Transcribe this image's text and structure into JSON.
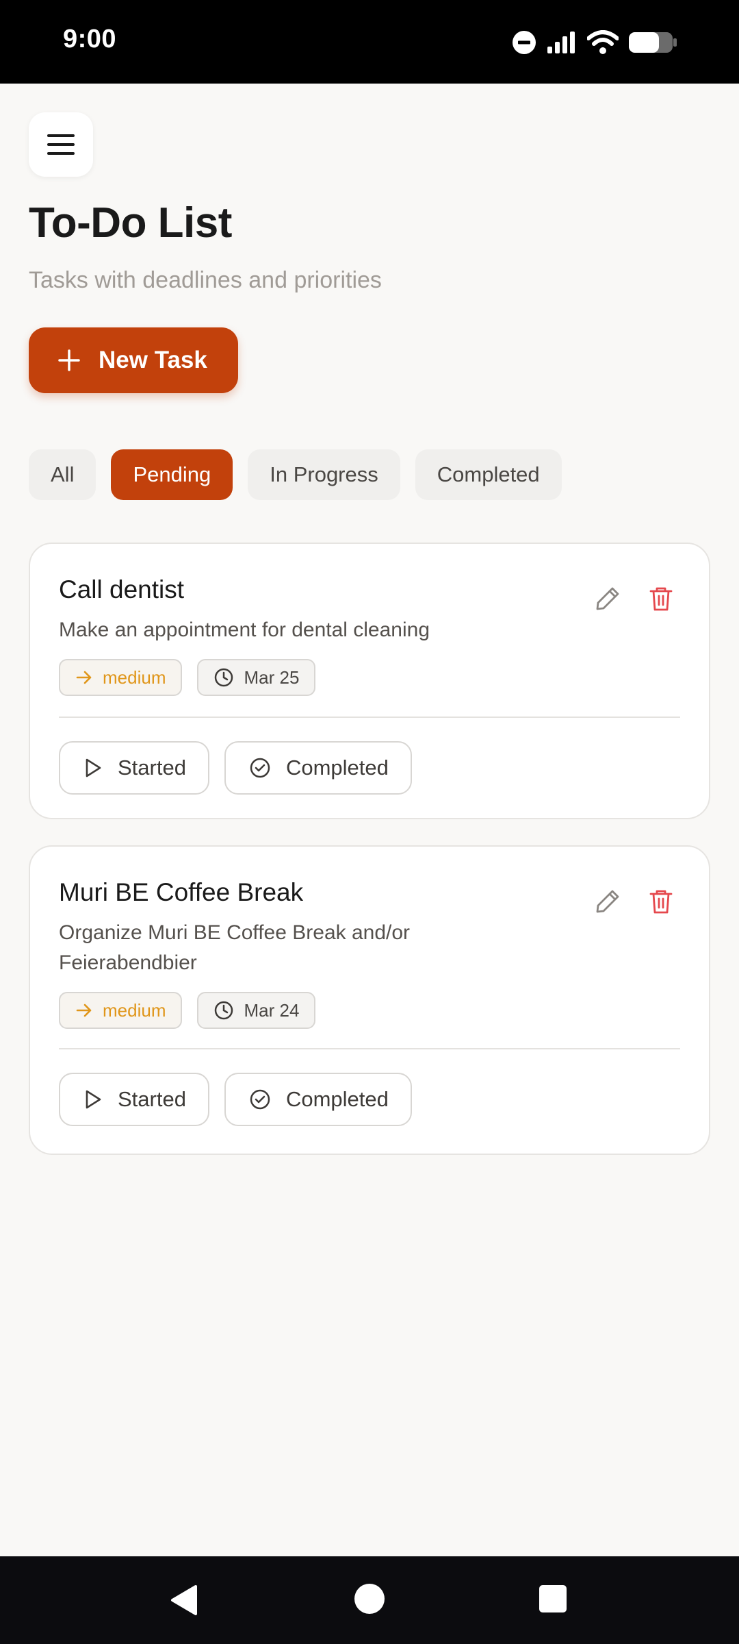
{
  "status_bar": {
    "time": "9:00"
  },
  "header": {
    "title": "To-Do List",
    "subtitle": "Tasks with deadlines and priorities",
    "new_task_label": "New Task"
  },
  "filters": [
    {
      "label": "All",
      "active": false
    },
    {
      "label": "Pending",
      "active": true
    },
    {
      "label": "In Progress",
      "active": false
    },
    {
      "label": "Completed",
      "active": false
    }
  ],
  "tasks": [
    {
      "title": "Call dentist",
      "description": "Make an appointment for dental cleaning",
      "priority": "medium",
      "due": "Mar 25",
      "actions": {
        "started": "Started",
        "completed": "Completed"
      }
    },
    {
      "title": "Muri BE Coffee Break",
      "description": "Organize Muri BE Coffee Break and/or Feierabendbier",
      "priority": "medium",
      "due": "Mar 24",
      "actions": {
        "started": "Started",
        "completed": "Completed"
      }
    }
  ],
  "colors": {
    "accent": "#c2410c",
    "priority_medium": "#e0961a",
    "delete": "#e5484d",
    "background": "#f9f8f6"
  },
  "icons": [
    "menu-icon",
    "plus-icon",
    "pencil-icon",
    "trash-icon",
    "arrow-right-icon",
    "clock-icon",
    "play-icon",
    "check-circle-icon"
  ]
}
